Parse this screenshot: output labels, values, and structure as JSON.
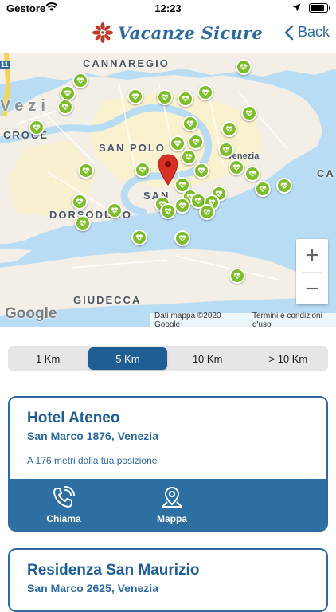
{
  "status_bar": {
    "carrier": "Gestore",
    "time": "12:23",
    "battery_level": 0.9
  },
  "nav": {
    "brand": "Vacanze Sicure",
    "back_label": "Back"
  },
  "map": {
    "labels": {
      "cannaregio": "CANNAREGIO",
      "venezia_partial": "Vezi",
      "croce_partial": "CROCE",
      "san_polo": "SAN POLO",
      "venezia": "Venezia",
      "ca_partial": "CA",
      "san_partial": "SAN",
      "dorsoduro": "DORSODURO",
      "giudecca": "GIUDECCA",
      "road_shield": "11"
    },
    "zoom_in": "+",
    "zoom_out": "−",
    "google": "Google",
    "data_credit": "Dati mappa ©2020 Google",
    "terms": "Termini e condizioni d'uso",
    "poi_color": "#7cbd28",
    "pin_color": "#d93025"
  },
  "distance_filter": {
    "options": [
      "1 Km",
      "5 Km",
      "10 Km",
      "> 10 Km"
    ],
    "selected": "5 Km"
  },
  "results": [
    {
      "name": "Hotel Ateneo",
      "address": "San Marco 1876, Venezia",
      "distance": "A 176 metri dalla tua posizione",
      "call_label": "Chiama",
      "map_label": "Mappa"
    },
    {
      "name": "Residenza San Maurizio",
      "address": "San Marco 2625, Venezia"
    }
  ],
  "colors": {
    "accent": "#2c6aa0",
    "active_segment": "#1f5e95",
    "card_footer": "#2d6ea3"
  }
}
